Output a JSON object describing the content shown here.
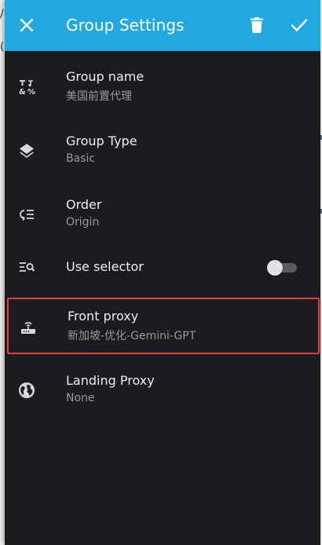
{
  "appbar": {
    "title": "Group Settings",
    "close_icon": "close-icon",
    "delete_icon": "trash-icon",
    "confirm_icon": "check-icon",
    "color": "#22a8df"
  },
  "settings": {
    "group_name": {
      "label": "Group name",
      "value": "美国前置代理",
      "icon": "text-format-icon"
    },
    "group_type": {
      "label": "Group Type",
      "value": "Basic",
      "icon": "layers-icon"
    },
    "order": {
      "label": "Order",
      "value": "Origin",
      "icon": "sort-icon"
    },
    "use_selector": {
      "label": "Use selector",
      "icon": "search-list-icon",
      "enabled": false
    },
    "front_proxy": {
      "label": "Front proxy",
      "value": "新加坡-优化-Gemini-GPT",
      "icon": "router-icon",
      "highlight_color": "#e0403a"
    },
    "landing_proxy": {
      "label": "Landing Proxy",
      "value": "None",
      "icon": "globe-icon"
    }
  },
  "colors": {
    "background": "#1b1c1f",
    "primary_text": "#eeeeee",
    "secondary_text": "#9a9a9a"
  }
}
